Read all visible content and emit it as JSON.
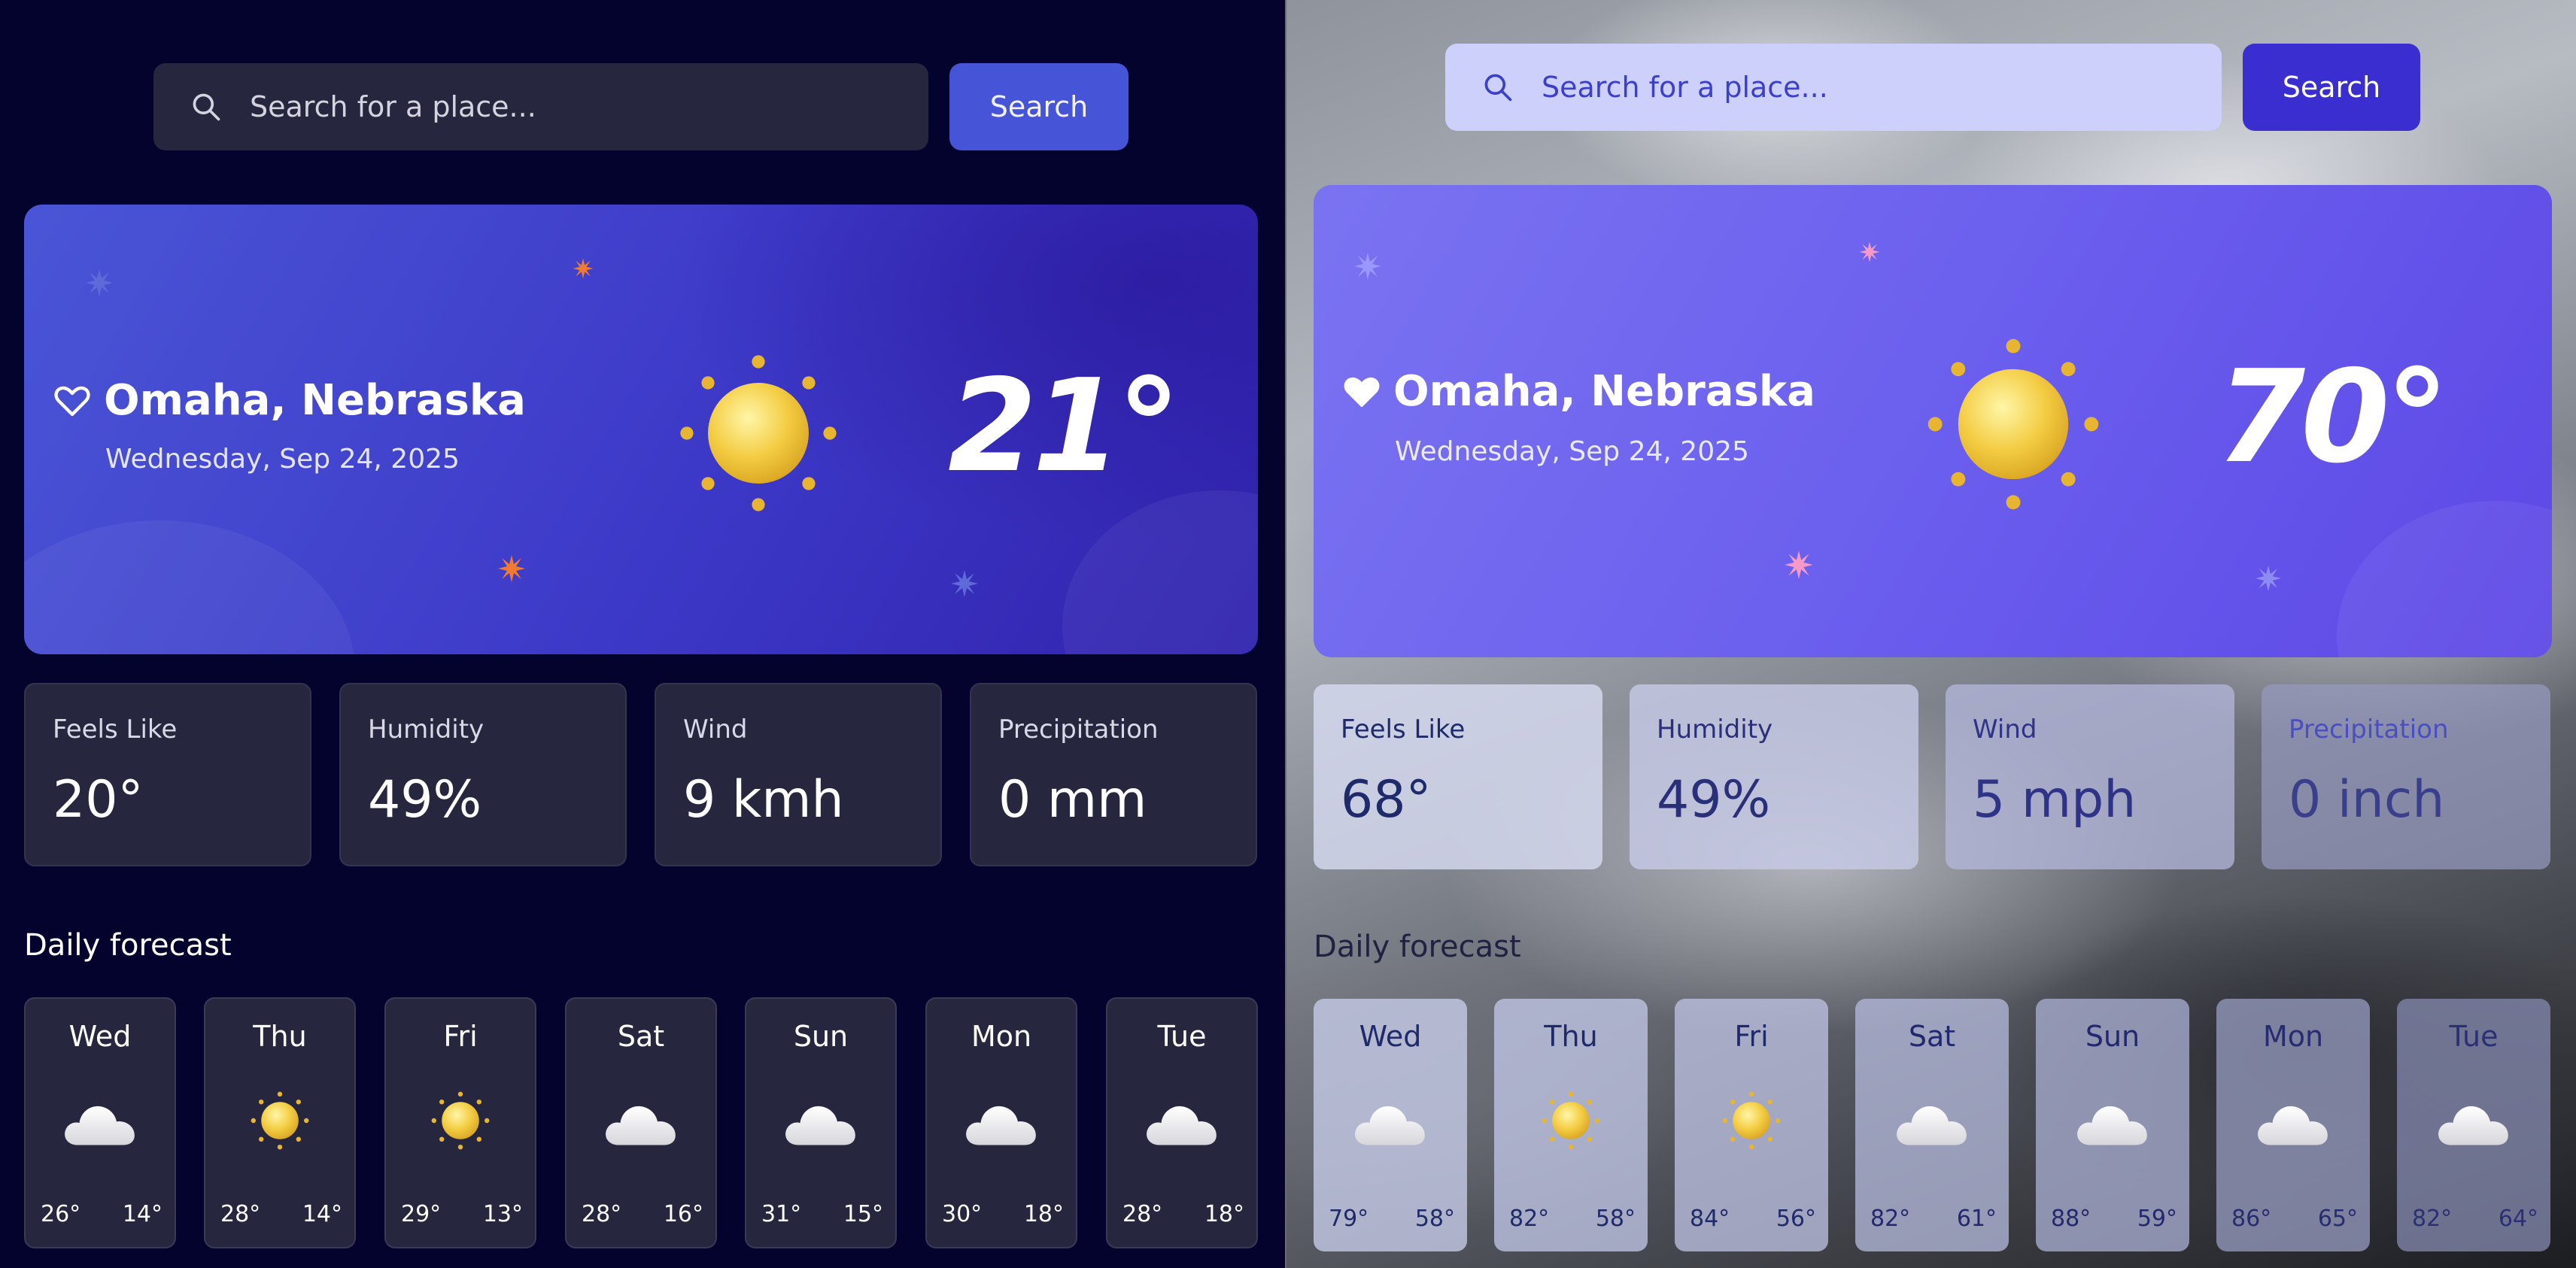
{
  "left_panel": {
    "search": {
      "placeholder": "Search for a place...",
      "button_label": "Search"
    },
    "hero": {
      "location": "Omaha, Nebraska",
      "date": "Wednesday, Sep 24, 2025",
      "temperature": "21°",
      "condition_icon": "sun-icon",
      "favorite_icon": "heart-outline-icon"
    },
    "stats": [
      {
        "label": "Feels Like",
        "value": "20°"
      },
      {
        "label": "Humidity",
        "value": "49%"
      },
      {
        "label": "Wind",
        "value": "9 kmh"
      },
      {
        "label": "Precipitation",
        "value": "0 mm"
      }
    ],
    "forecast_title": "Daily forecast",
    "forecast": [
      {
        "day": "Wed",
        "icon": "cloud-icon",
        "high": "26°",
        "low": "14°"
      },
      {
        "day": "Thu",
        "icon": "sun-icon",
        "high": "28°",
        "low": "14°"
      },
      {
        "day": "Fri",
        "icon": "sun-icon",
        "high": "29°",
        "low": "13°"
      },
      {
        "day": "Sat",
        "icon": "cloud-icon",
        "high": "28°",
        "low": "16°"
      },
      {
        "day": "Sun",
        "icon": "cloud-icon",
        "high": "31°",
        "low": "15°"
      },
      {
        "day": "Mon",
        "icon": "cloud-icon",
        "high": "30°",
        "low": "18°"
      },
      {
        "day": "Tue",
        "icon": "cloud-icon",
        "high": "28°",
        "low": "18°"
      }
    ]
  },
  "right_panel": {
    "search": {
      "placeholder": "Search for a place...",
      "button_label": "Search"
    },
    "hero": {
      "location": "Omaha, Nebraska",
      "date": "Wednesday, Sep 24, 2025",
      "temperature": "70°",
      "condition_icon": "sun-icon",
      "favorite_icon": "heart-filled-icon"
    },
    "stats": [
      {
        "label": "Feels Like",
        "value": "68°"
      },
      {
        "label": "Humidity",
        "value": "49%"
      },
      {
        "label": "Wind",
        "value": "5 mph"
      },
      {
        "label": "Precipitation",
        "value": "0 inch"
      }
    ],
    "forecast_title": "Daily forecast",
    "forecast": [
      {
        "day": "Wed",
        "icon": "cloud-icon",
        "high": "79°",
        "low": "58°"
      },
      {
        "day": "Thu",
        "icon": "sun-icon",
        "high": "82°",
        "low": "58°"
      },
      {
        "day": "Fri",
        "icon": "sun-icon",
        "high": "84°",
        "low": "56°"
      },
      {
        "day": "Sat",
        "icon": "cloud-icon",
        "high": "82°",
        "low": "61°"
      },
      {
        "day": "Sun",
        "icon": "cloud-icon",
        "high": "88°",
        "low": "59°"
      },
      {
        "day": "Mon",
        "icon": "cloud-icon",
        "high": "86°",
        "low": "65°"
      },
      {
        "day": "Tue",
        "icon": "cloud-icon",
        "high": "82°",
        "low": "64°"
      }
    ]
  },
  "colors": {
    "left_bg": "#03032e",
    "left_card": "#26263e",
    "left_accent": "#4654d8",
    "right_accent": "#3a2ed0",
    "right_hero": "#6b5fee",
    "right_text": "#2a2d6e"
  }
}
